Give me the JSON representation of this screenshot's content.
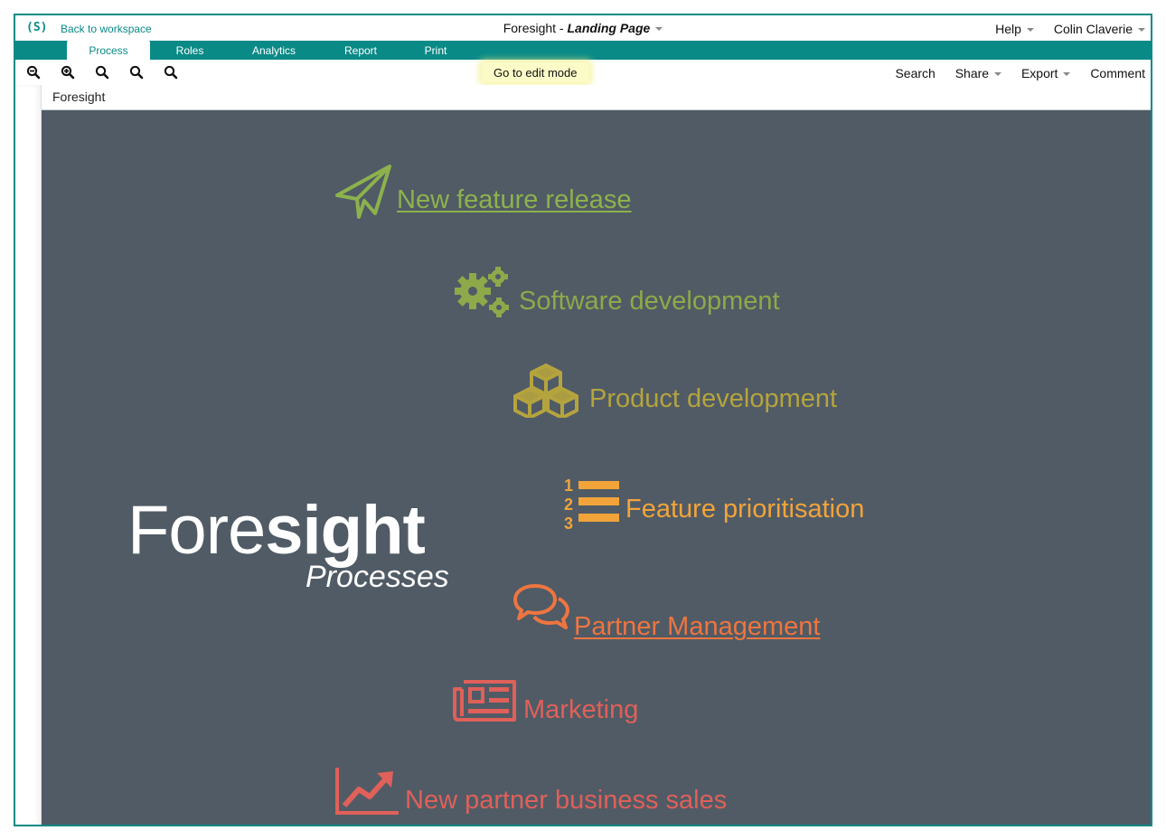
{
  "header": {
    "logo": "(S)",
    "back_label": "Back to workspace",
    "title_app": "Foresight - ",
    "title_page": "Landing Page",
    "help_label": "Help",
    "user_name": "Colin Claverie"
  },
  "tabs": [
    {
      "label": "Process",
      "active": true
    },
    {
      "label": "Roles"
    },
    {
      "label": "Analytics"
    },
    {
      "label": "Report"
    },
    {
      "label": "Print"
    }
  ],
  "toolbar": {
    "edit_mode_label": "Go to edit mode",
    "search_label": "Search",
    "share_label": "Share",
    "export_label": "Export",
    "comment_label": "Comment",
    "zoom_icons": [
      "zoom-out-icon",
      "zoom-in-icon",
      "zoom-icon",
      "zoom-icon",
      "zoom-icon"
    ]
  },
  "breadcrumb": {
    "label": "Foresight"
  },
  "canvas": {
    "background": "#505b65",
    "brand": {
      "name_light": "Fore",
      "name_bold": "sight",
      "subtitle": "Processes"
    },
    "processes": [
      {
        "label": "New feature release",
        "icon": "paper-plane-icon",
        "color": "#8db24d",
        "link": true
      },
      {
        "label": "Software development",
        "icon": "gears-icon",
        "color": "#8ea94a",
        "link": false
      },
      {
        "label": "Product development",
        "icon": "cubes-icon",
        "color": "#b5a43e",
        "link": false
      },
      {
        "label": "Feature prioritisation",
        "icon": "numbered-list-icon",
        "color": "#f2a43a",
        "link": false
      },
      {
        "label": "Partner Management",
        "icon": "chat-bubbles-icon",
        "color": "#ee7540",
        "link": true
      },
      {
        "label": "Marketing",
        "icon": "newspaper-icon",
        "color": "#e0605a",
        "link": false
      },
      {
        "label": "New partner business sales",
        "icon": "line-chart-icon",
        "color": "#e0605a",
        "link": false
      }
    ]
  },
  "colors": {
    "accent": "#0a8a87",
    "highlight": "#fbfbc8"
  }
}
